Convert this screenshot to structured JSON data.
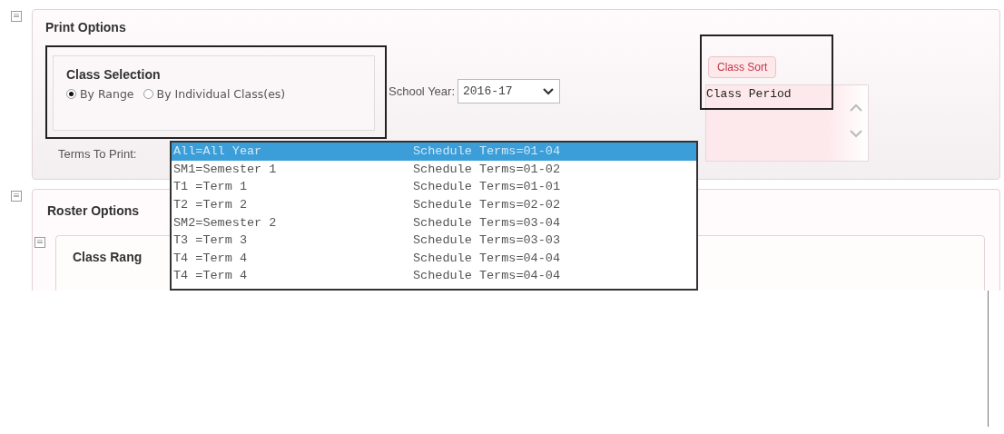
{
  "print_options": {
    "title": "Print Options",
    "class_selection": {
      "title": "Class Selection",
      "options": [
        {
          "label": "By Range",
          "selected": true
        },
        {
          "label": "By Individual Class(es)",
          "selected": false
        }
      ]
    },
    "school_year": {
      "label": "School Year:",
      "value": "2016-17"
    },
    "class_sort_button": "Class Sort",
    "sort_list": {
      "items": [
        "Class Period"
      ]
    },
    "terms_to_print": {
      "label": "Terms To Print:",
      "options": [
        {
          "code": "All=All Year",
          "description": "Schedule Terms=01-04",
          "selected": true
        },
        {
          "code": "SM1=Semester 1",
          "description": "Schedule Terms=01-02",
          "selected": false
        },
        {
          "code": "T1 =Term 1",
          "description": "Schedule Terms=01-01",
          "selected": false
        },
        {
          "code": "T2 =Term 2",
          "description": "Schedule Terms=02-02",
          "selected": false
        },
        {
          "code": "SM2=Semester 2",
          "description": "Schedule Terms=03-04",
          "selected": false
        },
        {
          "code": "T3 =Term 3",
          "description": "Schedule Terms=03-03",
          "selected": false
        },
        {
          "code": "T4 =Term 4",
          "description": "Schedule Terms=04-04",
          "selected": false
        },
        {
          "code": "T4 =Term 4",
          "description": "Schedule Terms=04-04",
          "selected": false
        }
      ]
    }
  },
  "roster_options": {
    "title": "Roster Options",
    "class_range": {
      "title": "Class Rang"
    }
  }
}
